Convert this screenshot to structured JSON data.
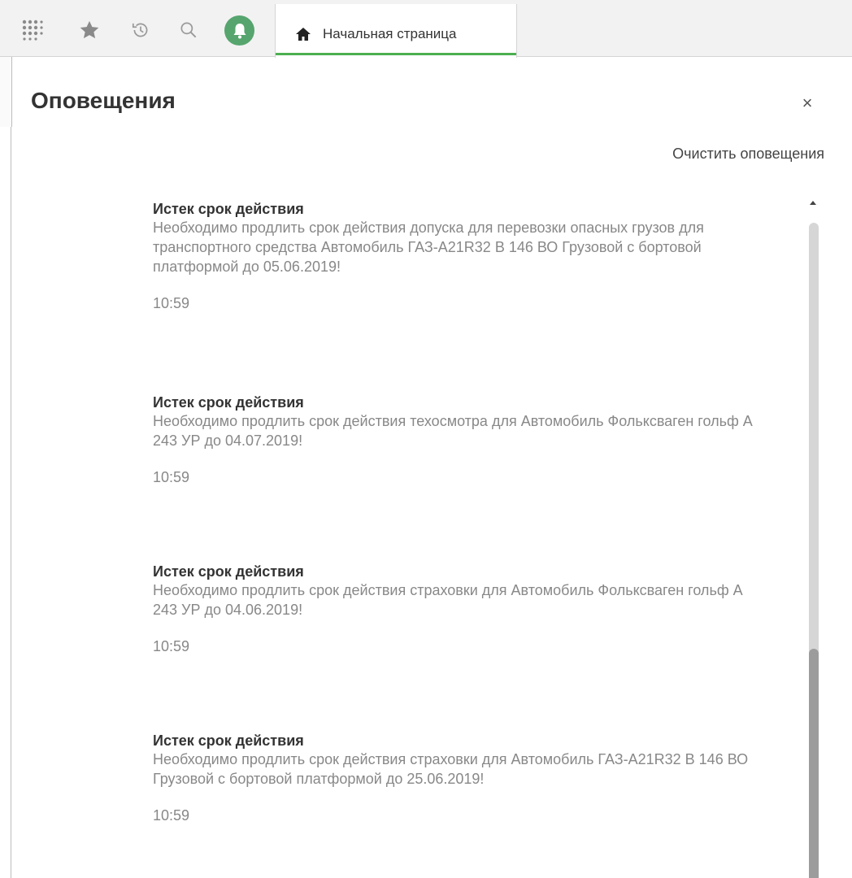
{
  "toolbar": {
    "apps_icon": "grid-icon",
    "favorites_icon": "star-icon",
    "history_icon": "history-icon",
    "search_icon": "search-icon",
    "notifications_icon": "bell-icon",
    "notifications_color": "#56a56e"
  },
  "tabs": [
    {
      "label": "Начальная страница",
      "icon": "home-icon",
      "active": true,
      "accent": "#4caf50"
    }
  ],
  "panel": {
    "title": "Оповещения",
    "close_label": "×",
    "clear_label": "Очистить оповещения"
  },
  "notifications": [
    {
      "title": "Истек срок действия",
      "text": "Необходимо продлить срок действия допуска для перевозки опасных грузов для транспортного средства Автомобиль ГАЗ-А21R32 В 146 ВО Грузовой с бортовой платформой  до 05.06.2019!",
      "time": "10:59"
    },
    {
      "title": "Истек срок действия",
      "text": "Необходимо продлить срок действия техосмотра для Автомобиль Фольксваген гольф  А 243 УР до 04.07.2019!",
      "time": "10:59"
    },
    {
      "title": "Истек срок действия",
      "text": "Необходимо продлить срок действия страховки для Автомобиль Фольксваген гольф  А 243 УР до 04.06.2019!",
      "time": "10:59"
    },
    {
      "title": "Истек срок действия",
      "text": "Необходимо продлить срок действия страховки для Автомобиль ГАЗ-А21R32 В 146 ВО Грузовой с бортовой платформой  до 25.06.2019!",
      "time": "10:59"
    }
  ]
}
